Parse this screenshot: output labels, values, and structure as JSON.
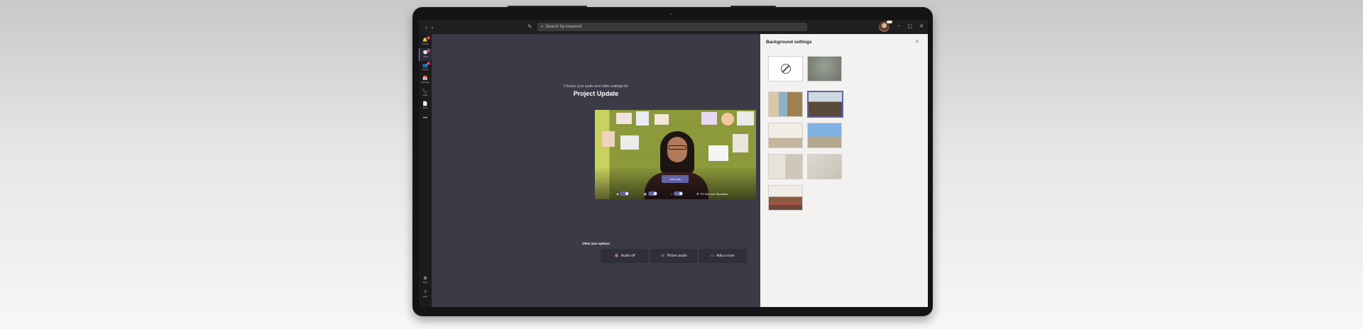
{
  "window": {
    "search_placeholder": "Search by keyword",
    "nav_back": "‹",
    "nav_forward": "›",
    "compose": "✎",
    "minimize": "–",
    "maximize": "▢",
    "close": "✕"
  },
  "rail": {
    "items": [
      {
        "icon": "🔔",
        "label": "Activity",
        "badge": "2"
      },
      {
        "icon": "💬",
        "label": "Chat",
        "badge": "1"
      },
      {
        "icon": "👥",
        "label": "Teams",
        "badge": "3"
      },
      {
        "icon": "📅",
        "label": "Calendar",
        "badge": ""
      },
      {
        "icon": "📞",
        "label": "Calls",
        "badge": ""
      },
      {
        "icon": "📄",
        "label": "Files",
        "badge": ""
      },
      {
        "icon": "•••",
        "label": "",
        "badge": ""
      }
    ],
    "bottom": [
      {
        "icon": "⊞",
        "label": "Apps"
      },
      {
        "icon": "?",
        "label": "Help"
      }
    ]
  },
  "prejoin": {
    "prompt": "Choose your audio and video settings for",
    "meeting_title": "Project Update",
    "join_label": "Join now",
    "device_label": "PC Mic and Speakers",
    "other_options_title": "Other join options",
    "options": [
      {
        "icon": "🔇",
        "label": "Audio off"
      },
      {
        "icon": "☏",
        "label": "Phone audio"
      },
      {
        "icon": "▭",
        "label": "Add a room"
      }
    ]
  },
  "background_panel": {
    "title": "Background settings",
    "close": "✕"
  },
  "colors": {
    "accent": "#6264a7",
    "stage": "#3b3a47",
    "panel": "#f3f2f1"
  }
}
